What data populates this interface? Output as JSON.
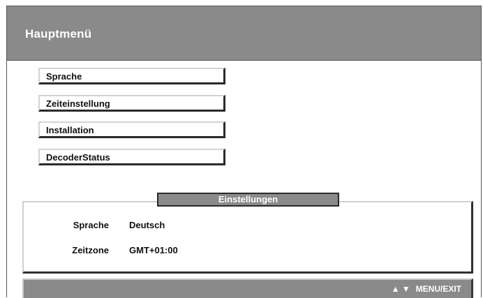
{
  "header": {
    "title": "Hauptmenü"
  },
  "menu": {
    "items": [
      {
        "label": "Sprache"
      },
      {
        "label": "Zeiteinstellung"
      },
      {
        "label": "Installation"
      },
      {
        "label": "DecoderStatus"
      }
    ]
  },
  "settings": {
    "title": "Einstellungen",
    "rows": [
      {
        "key": "Sprache",
        "value": "Deutsch"
      },
      {
        "key": "Zeitzone",
        "value": "GMT+01:00"
      }
    ]
  },
  "footer": {
    "arrows": "▲ ▼",
    "hint": "MENU/EXIT"
  }
}
